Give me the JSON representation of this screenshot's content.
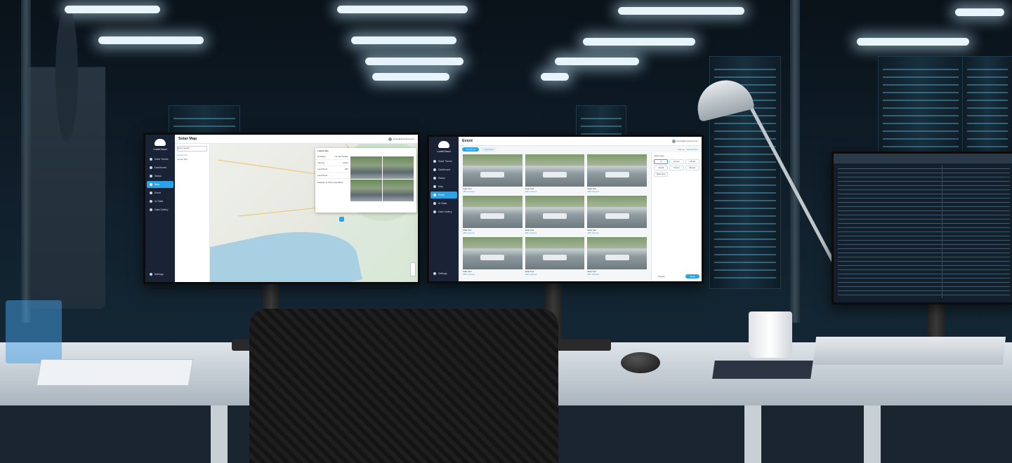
{
  "scene": {
    "accent": "#2aa4e8",
    "sidebar_color": "#1a2236"
  },
  "map_app": {
    "logo": "LumiCloud",
    "title": "Solar Map",
    "user": "admin@lumicloud.com",
    "nav": [
      {
        "label": "Solar Tracks",
        "icon": "sun-icon"
      },
      {
        "label": "Dashboard",
        "icon": "grid-icon"
      },
      {
        "label": "Status",
        "icon": "status-icon"
      },
      {
        "label": "Map",
        "icon": "map-icon",
        "active": true
      },
      {
        "label": "Event",
        "icon": "event-icon"
      },
      {
        "label": "AI Stats",
        "icon": "chart-icon"
      },
      {
        "label": "Data Gallery",
        "icon": "gallery-icon"
      }
    ],
    "settings": "Settings",
    "list_search_placeholder": "Enter search",
    "list_group": "Group (13)",
    "list_item": "Lumen Spt...",
    "popup": {
      "header": "Lumen Spt",
      "rows": [
        {
          "k": "AI status",
          "v": "AI Vid Tracker"
        },
        {
          "k": "Internet",
          "v": "Active"
        },
        {
          "k": "Last Photo",
          "v": "307"
        },
        {
          "k": "Last Photo",
          "v": "..."
        }
      ],
      "note": "Network is 12% powerbank"
    },
    "bottom_button": "Add new equipment"
  },
  "event_app": {
    "logo": "LumiCloud",
    "title": "Event",
    "user": "admin@lumicloud.com",
    "nav": [
      {
        "label": "Solar Tracks",
        "icon": "sun-icon"
      },
      {
        "label": "Dashboard",
        "icon": "grid-icon"
      },
      {
        "label": "Status",
        "icon": "status-icon"
      },
      {
        "label": "Map",
        "icon": "map-icon"
      },
      {
        "label": "Event",
        "icon": "event-icon",
        "active": true
      },
      {
        "label": "AI Stats",
        "icon": "chart-icon"
      },
      {
        "label": "Data Gallery",
        "icon": "gallery-icon"
      }
    ],
    "settings": "Settings",
    "tabs": [
      "Thumbnail",
      "List View"
    ],
    "sort_label": "Sort by",
    "sort_value": "Newest First",
    "cards": [
      {
        "title": "Solar Tool",
        "sub": "ABC Camera"
      },
      {
        "title": "Solar Tool",
        "sub": "ABC Camera"
      },
      {
        "title": "Solar Tool",
        "sub": "ABC Camera"
      },
      {
        "title": "Solar Tool",
        "sub": "ABC Camera"
      },
      {
        "title": "Solar Tool",
        "sub": "ABC Camera"
      },
      {
        "title": "Solar Tool",
        "sub": "ABC Camera"
      },
      {
        "title": "Solar Tool",
        "sub": "ABC Camera"
      },
      {
        "title": "Solar Tool",
        "sub": "ABC Camera"
      },
      {
        "title": "Solar Tool",
        "sub": "ABC Camera"
      }
    ],
    "filter_title": "Select type",
    "filter_chips": [
      "All",
      "Human",
      "Vehicle",
      "Animal",
      "Person",
      "Bicycle",
      "Motorcycle"
    ],
    "cancel": "Cancel",
    "apply": "Apply"
  }
}
